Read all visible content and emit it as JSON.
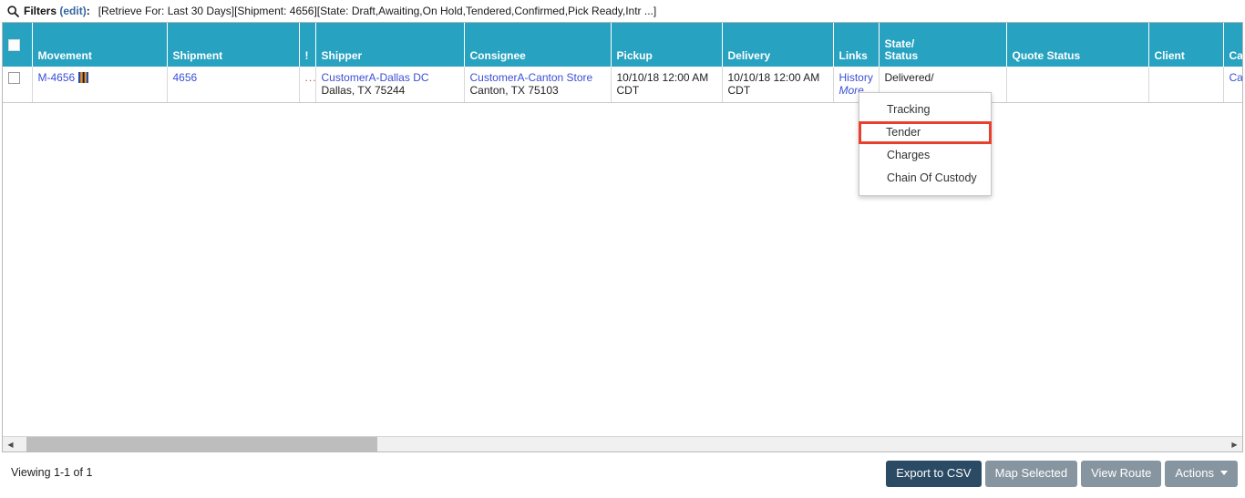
{
  "filter_bar": {
    "icon": "search-icon",
    "label": "Filters",
    "edit_link": "(edit)",
    "colon": ":",
    "expression": "[Retrieve For: Last 30 Days][Shipment: 4656][State: Draft,Awaiting,On Hold,Tendered,Confirmed,Pick Ready,Intr ...]"
  },
  "grid": {
    "columns": [
      {
        "key": "check",
        "label": "",
        "label2": ""
      },
      {
        "key": "movement",
        "label": "Movement",
        "label2": ""
      },
      {
        "key": "shipment",
        "label": "Shipment",
        "label2": ""
      },
      {
        "key": "bang",
        "label": "!",
        "label2": ""
      },
      {
        "key": "shipper",
        "label": "Shipper",
        "label2": ""
      },
      {
        "key": "consignee",
        "label": "Consignee",
        "label2": ""
      },
      {
        "key": "pickup",
        "label": "Pickup",
        "label2": ""
      },
      {
        "key": "delivery",
        "label": "Delivery",
        "label2": ""
      },
      {
        "key": "links",
        "label": "Links",
        "label2": ""
      },
      {
        "key": "state_status",
        "label": "State/",
        "label2": "Status"
      },
      {
        "key": "quote_status",
        "label": "Quote Status",
        "label2": ""
      },
      {
        "key": "client",
        "label": "Client",
        "label2": ""
      },
      {
        "key": "carrier",
        "label": "Car",
        "label2": ""
      }
    ],
    "rows": [
      {
        "movement": "M-4656",
        "movement_icon": "map-icon",
        "shipment": "4656",
        "bang": "...",
        "shipper_name": "CustomerA-Dallas DC",
        "shipper_city": "Dallas, TX 75244",
        "consignee_name": "CustomerA-Canton Store",
        "consignee_city": "Canton, TX 75103",
        "pickup_date": "10/10/18 12:00 AM",
        "pickup_tz": "CDT",
        "delivery_date": "10/10/18 12:00 AM",
        "delivery_tz": "CDT",
        "links_history": "History",
        "links_more": "More...",
        "state_status": "Delivered/",
        "quote_status": "",
        "client": "",
        "carrier": "Car"
      }
    ]
  },
  "link_menu": {
    "items": [
      {
        "label": "Tracking",
        "selected": false
      },
      {
        "label": "Tender",
        "selected": true
      },
      {
        "label": "Charges",
        "selected": false
      },
      {
        "label": "Chain Of Custody",
        "selected": false
      }
    ],
    "highlight_color": "#e8402f"
  },
  "scrollbar": {
    "left_arrow": "◀",
    "right_arrow": "▶"
  },
  "footer": {
    "viewing": "Viewing 1-1 of 1",
    "buttons": [
      {
        "label": "Export to CSV",
        "style": "primary",
        "caret": false
      },
      {
        "label": "Map Selected",
        "style": "normal",
        "caret": false
      },
      {
        "label": "View Route",
        "style": "normal",
        "caret": false
      },
      {
        "label": "Actions",
        "style": "normal",
        "caret": true
      }
    ]
  },
  "theme": {
    "header_teal": "#27a2c0",
    "link_blue": "#3b4fd4",
    "edit_blue": "#3465a4",
    "btn_gray": "#8795a1",
    "btn_primary": "#2b4a63"
  }
}
